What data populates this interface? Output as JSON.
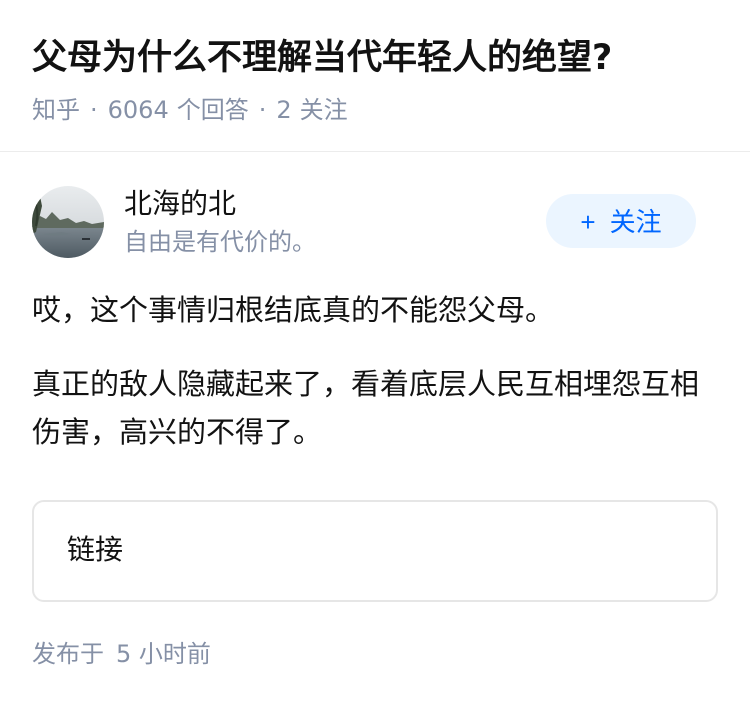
{
  "question": {
    "title": "父母为什么不理解当代年轻人的绝望?",
    "source": "知乎",
    "separator": "·",
    "answer_count": "6064",
    "answer_label": "个回答",
    "follower_count": "2",
    "follower_label": "关注"
  },
  "author": {
    "name": "北海的北",
    "bio": "自由是有代价的。",
    "follow_plus": "+",
    "follow_label": "关注"
  },
  "answer": {
    "paragraphs": [
      "哎，这个事情归根结底真的不能怨父母。",
      "真正的敌人隐藏起来了，看着底层人民互相埋怨互相伤害，高兴的不得了。"
    ]
  },
  "link_card": {
    "label": "链接"
  },
  "footer": {
    "published_prefix": "发布于",
    "published_time": "5 小时前"
  },
  "colors": {
    "title": "#121212",
    "meta": "#8590a6",
    "accent": "#0066ff",
    "follow_bg": "#ebf5ff",
    "divider": "#ececec",
    "card_border": "#e6e6e6"
  }
}
